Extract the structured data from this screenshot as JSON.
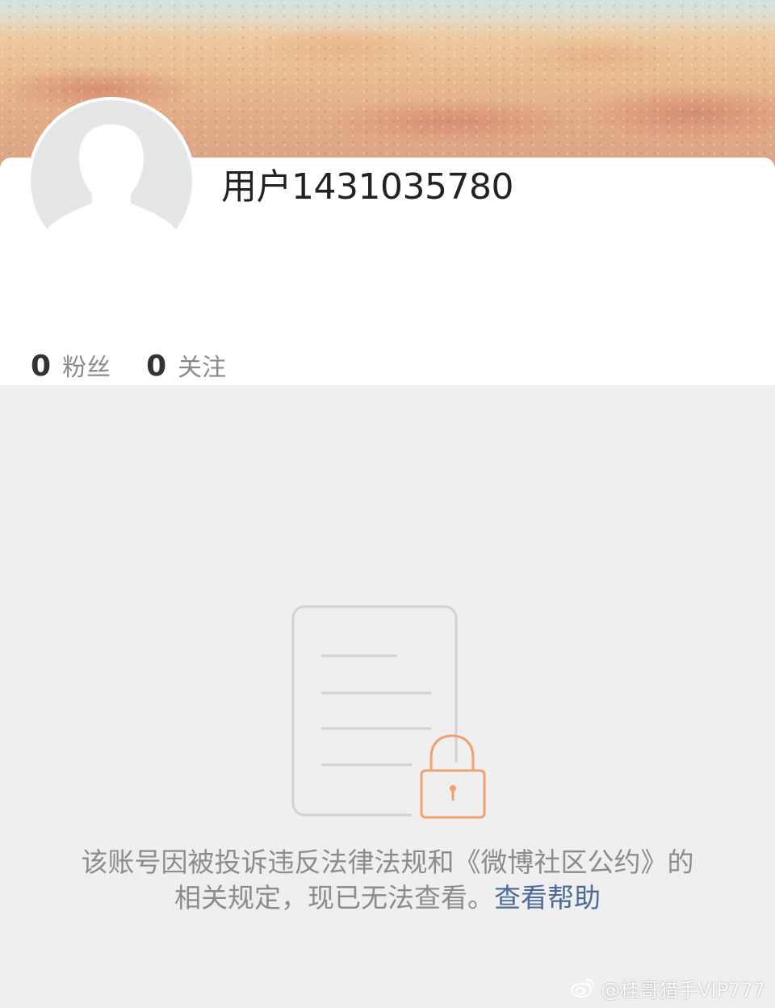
{
  "profile": {
    "username": "用户1431035780",
    "avatar_icon": "default-avatar-silhouette-icon",
    "stats": [
      {
        "count": "0",
        "label": "粉丝"
      },
      {
        "count": "0",
        "label": "关注"
      }
    ]
  },
  "notice": {
    "icon": "locked-document-icon",
    "message": "该账号因被投诉违反法律法规和《微博社区公约》的相关规定，现已无法查看。",
    "help_link": "查看帮助"
  },
  "watermark": {
    "text": "@桂哥猎手VIP777",
    "icon": "weibo-logo-icon"
  },
  "colors": {
    "lock_accent": "#f0a06c",
    "link": "#4d6a99",
    "page_background": "#efefef"
  }
}
